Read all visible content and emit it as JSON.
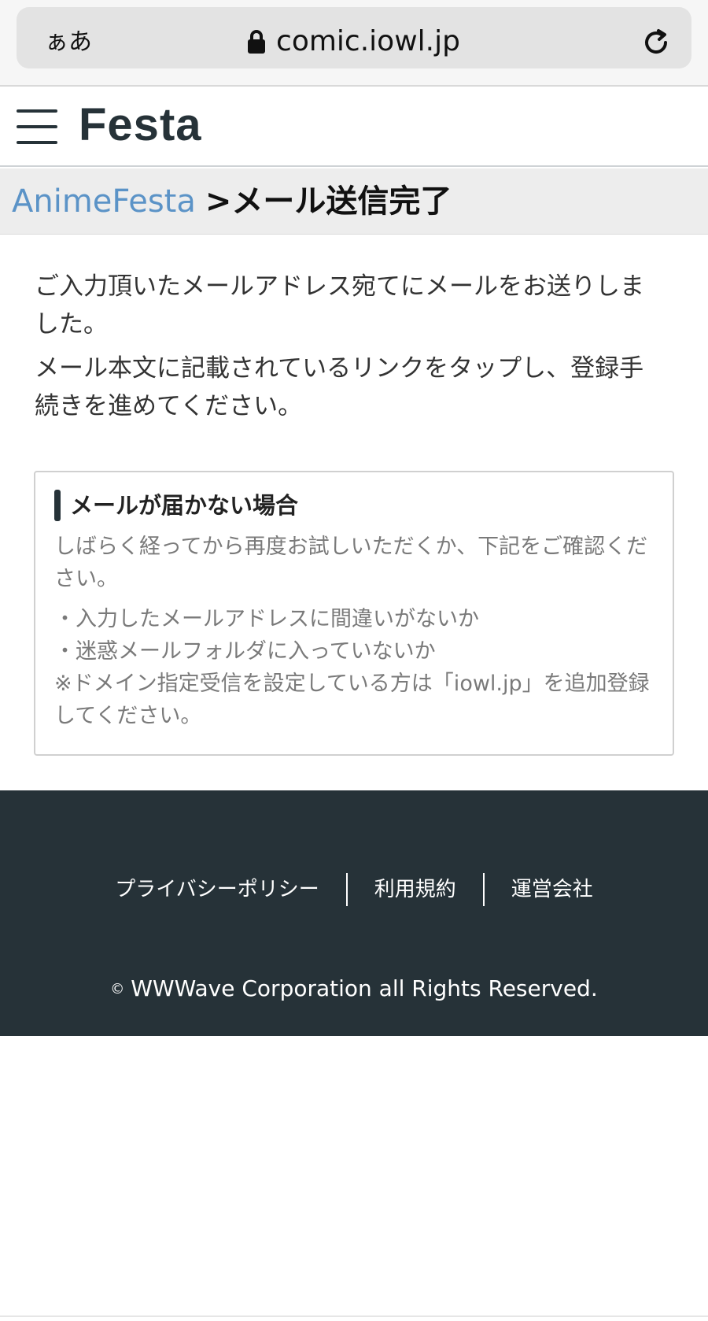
{
  "browser": {
    "text_size_label": "ぁあ",
    "url": "comic.iowl.jp"
  },
  "header": {
    "logo": "Festa"
  },
  "breadcrumb": {
    "link": "AnimeFesta",
    "current": ">メール送信完了"
  },
  "main": {
    "message_1": "ご入力頂いたメールアドレス宛てにメールをお送りしました。",
    "message_2": "メール本文に記載されているリンクをタップし、登録手続きを進めてください。"
  },
  "notice": {
    "title": "メールが届かない場合",
    "text": "しばらく経ってから再度お試しいただくか、下記をご確認ください。",
    "items": [
      "・入力したメールアドレスに間違いがないか",
      "・迷惑メールフォルダに入っていないか"
    ],
    "note": "※ドメイン指定受信を設定している方は「iowl.jp」を追加登録してください。"
  },
  "footer": {
    "links": [
      "プライバシーポリシー",
      "利用規約",
      "運営会社"
    ],
    "copyright_symbol": "©",
    "copyright": "WWWave Corporation all Rights Reserved."
  }
}
